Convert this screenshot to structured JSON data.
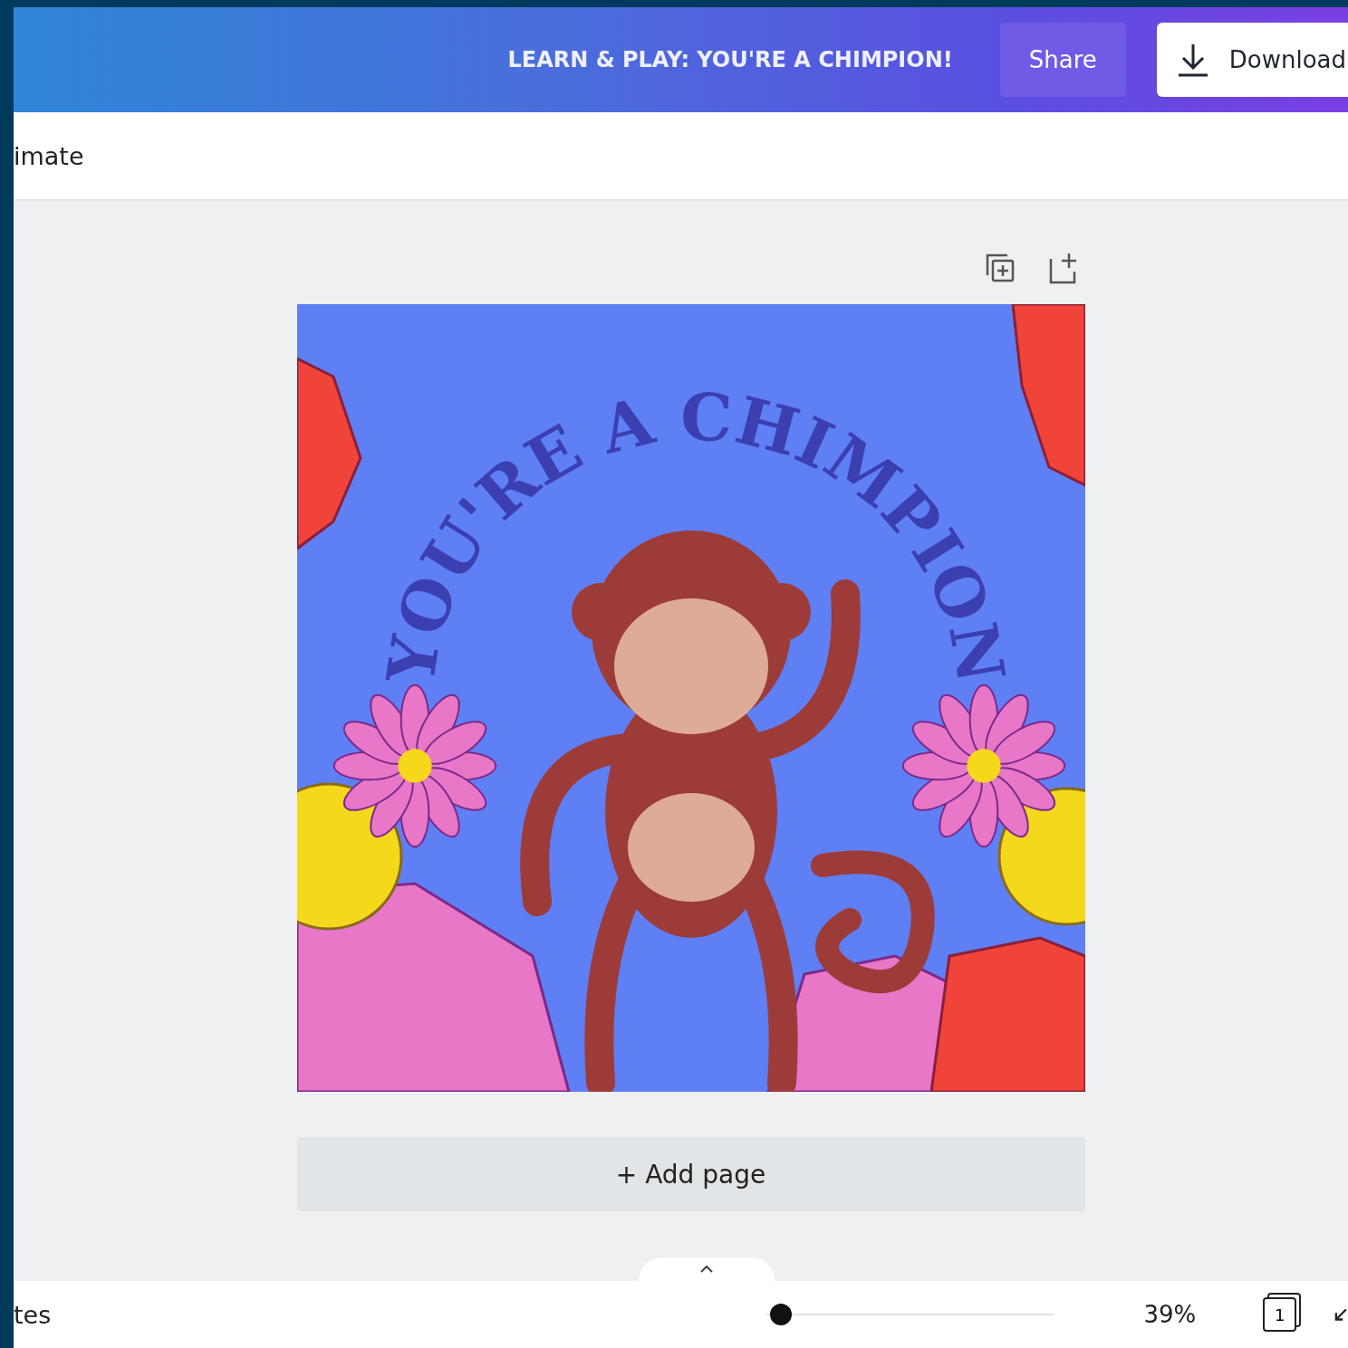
{
  "header": {
    "design_title": "LEARN & PLAY: YOU'RE A CHIMPION!",
    "share_button": "Share",
    "download_button": "Download"
  },
  "toolbar": {
    "item": "imate"
  },
  "design": {
    "headline": "YOU'RE A CHIMPION"
  },
  "add_page_button": "+ Add page",
  "footer": {
    "left_label": "tes",
    "zoom": {
      "level": 0.05
    },
    "zoom_reading": "39%",
    "page_count": "1"
  }
}
